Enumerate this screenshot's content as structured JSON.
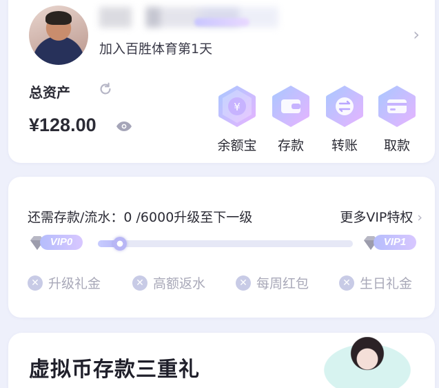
{
  "profile": {
    "days_label": "加入百胜体育第1天"
  },
  "assets": {
    "title": "总资产",
    "amount": "¥128.00"
  },
  "actions": [
    {
      "label": "余额宝",
      "icon": "yuan-icon"
    },
    {
      "label": "存款",
      "icon": "wallet-icon"
    },
    {
      "label": "转账",
      "icon": "transfer-icon"
    },
    {
      "label": "取款",
      "icon": "card-icon"
    }
  ],
  "vip": {
    "status_text": "还需存款/流水：0 /6000升级至下一级",
    "more_label": "更多VIP特权",
    "current_level": "VIP0",
    "next_level": "VIP1",
    "progress": 0,
    "perks": [
      "升级礼金",
      "高额返水",
      "每周红包",
      "生日礼金"
    ]
  },
  "promo": {
    "title": "虚拟币存款三重礼"
  },
  "colors": {
    "accent": "#9c8cf5",
    "icon_gradient_start": "#a8c8ff",
    "icon_gradient_end": "#e7b3ff"
  }
}
